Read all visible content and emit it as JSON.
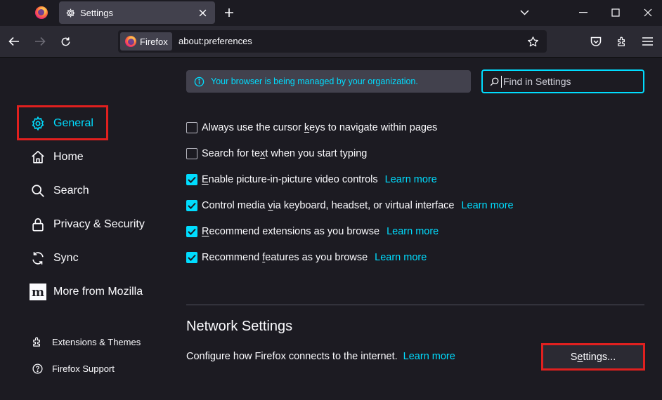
{
  "browser": {
    "pinned_tab_icon": "firefox-logo",
    "active_tab": {
      "title": "Settings",
      "icon": "gear-icon"
    },
    "identity_label": "Firefox",
    "url": "about:preferences"
  },
  "sidebar": {
    "categories": [
      {
        "label": "General",
        "icon": "gear-icon",
        "selected": true
      },
      {
        "label": "Home",
        "icon": "home-icon"
      },
      {
        "label": "Search",
        "icon": "search-icon"
      },
      {
        "label": "Privacy & Security",
        "icon": "lock-icon"
      },
      {
        "label": "Sync",
        "icon": "sync-icon"
      },
      {
        "label": "More from Mozilla",
        "icon": "mozilla-m-icon"
      }
    ],
    "footer": [
      {
        "label": "Extensions & Themes",
        "icon": "puzzle-icon"
      },
      {
        "label": "Firefox Support",
        "icon": "help-icon"
      }
    ]
  },
  "main": {
    "policy_banner": "Your browser is being managed by your organization.",
    "search_placeholder": "Find in Settings",
    "learn_more": "Learn more",
    "options": [
      {
        "label": "Always use the cursor keys to navigate within pages",
        "checked": false
      },
      {
        "label": "Search for text when you start typing",
        "checked": false
      },
      {
        "label": "Enable picture-in-picture video controls",
        "checked": true,
        "learn_more": true
      },
      {
        "label": "Control media via keyboard, headset, or virtual interface",
        "checked": true,
        "learn_more": true
      },
      {
        "label": "Recommend extensions as you browse",
        "checked": true,
        "learn_more": true
      },
      {
        "label": "Recommend features as you browse",
        "checked": true,
        "learn_more": true
      }
    ],
    "network": {
      "title": "Network Settings",
      "description": "Configure how Firefox connects to the internet.",
      "learn_more": "Learn more",
      "button": "Settings..."
    }
  },
  "colors": {
    "accent": "#00ddff",
    "highlight": "#e0201f",
    "background": "#1c1b22"
  }
}
